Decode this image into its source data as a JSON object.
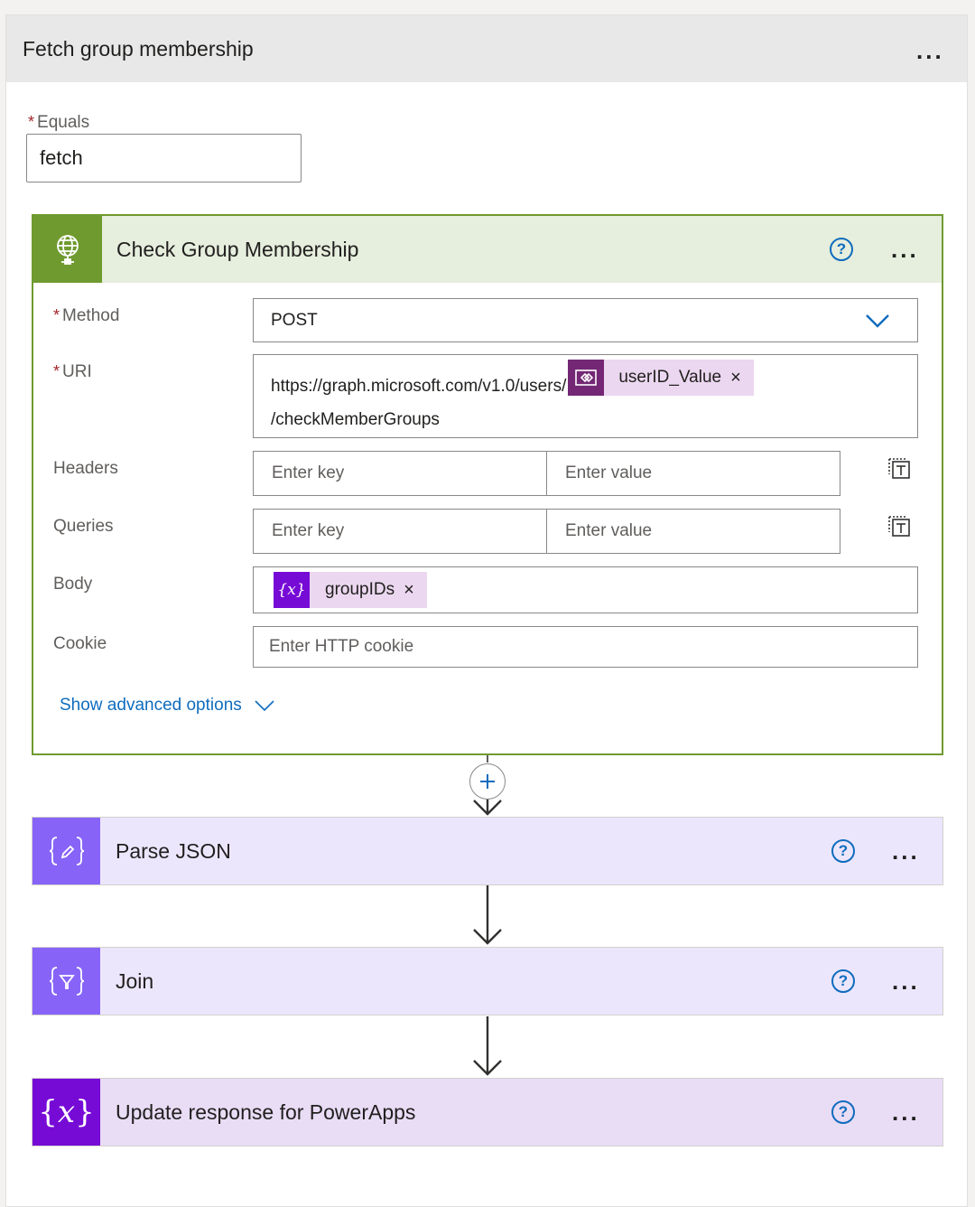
{
  "scope": {
    "title": "Fetch group membership",
    "menu": "...",
    "equals_label": "Equals",
    "equals_value": "fetch"
  },
  "check": {
    "title": "Check Group Membership",
    "help": "?",
    "menu": "...",
    "method_label": "Method",
    "method_value": "POST",
    "uri_label": "URI",
    "uri_prefix": "https://graph.microsoft.com/v1.0/users/",
    "uri_token": "userID_Value",
    "uri_suffix": "/checkMemberGroups",
    "headers_label": "Headers",
    "queries_label": "Queries",
    "key_placeholder": "Enter key",
    "value_placeholder": "Enter value",
    "body_label": "Body",
    "body_token": "groupIDs",
    "cookie_label": "Cookie",
    "cookie_placeholder": "Enter HTTP cookie",
    "advanced": "Show advanced options",
    "token_close": "×"
  },
  "steps": [
    {
      "title": "Parse JSON",
      "help": "?",
      "menu": "...",
      "icon": "parse-json-icon",
      "color": "#8764f7"
    },
    {
      "title": "Join",
      "help": "?",
      "menu": "...",
      "icon": "join-icon",
      "color": "#8764f7"
    },
    {
      "title": "Update response for PowerApps",
      "help": "?",
      "menu": "...",
      "icon": "variable-icon",
      "color": "#770bd6"
    }
  ],
  "colors": {
    "check_accent": "#6f9a2f",
    "check_header_bg": "#e6eedd",
    "step_bg": "#ece6fd",
    "variable_bg": "#e9dcf5",
    "link": "#0f6cbd",
    "required": "#a4262c"
  }
}
